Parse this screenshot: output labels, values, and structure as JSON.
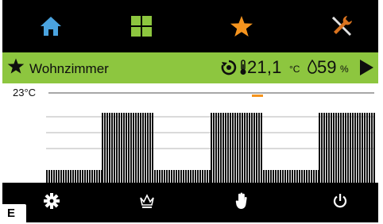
{
  "nav": {
    "home_icon": "home-icon",
    "grid_icon": "grid-icon",
    "favorites_icon": "star-icon",
    "tools_icon": "tools-icon",
    "colors": {
      "home": "#4aa3df",
      "grid": "#8dc63f",
      "favorites": "#f5941e",
      "tools": "#e0e0e0"
    }
  },
  "room": {
    "name": "Wohnzimmer",
    "temperature": "21,1",
    "temperature_unit": "°C",
    "humidity": "59",
    "humidity_unit": "%",
    "bar_color": "#8dc63f"
  },
  "chart": {
    "setpoint_label": "23°C"
  },
  "chart_data": {
    "type": "bar",
    "pattern": "striped weekly heating schedule blocks",
    "y_reference": "23°C",
    "blocks": [
      {
        "level": "low",
        "x_start": 0.0,
        "x_end": 0.17
      },
      {
        "level": "high",
        "x_start": 0.17,
        "x_end": 0.33
      },
      {
        "level": "low",
        "x_start": 0.33,
        "x_end": 0.5
      },
      {
        "level": "high",
        "x_start": 0.5,
        "x_end": 0.66
      },
      {
        "level": "low",
        "x_start": 0.66,
        "x_end": 0.83
      },
      {
        "level": "high",
        "x_start": 0.83,
        "x_end": 1.0
      }
    ],
    "marker_color": "#f5941e"
  },
  "bottom": {
    "settings_icon": "gear-icon",
    "crown_icon": "crown-icon",
    "manual_icon": "hand-icon",
    "power_icon": "power-icon"
  },
  "corner_label": "E"
}
